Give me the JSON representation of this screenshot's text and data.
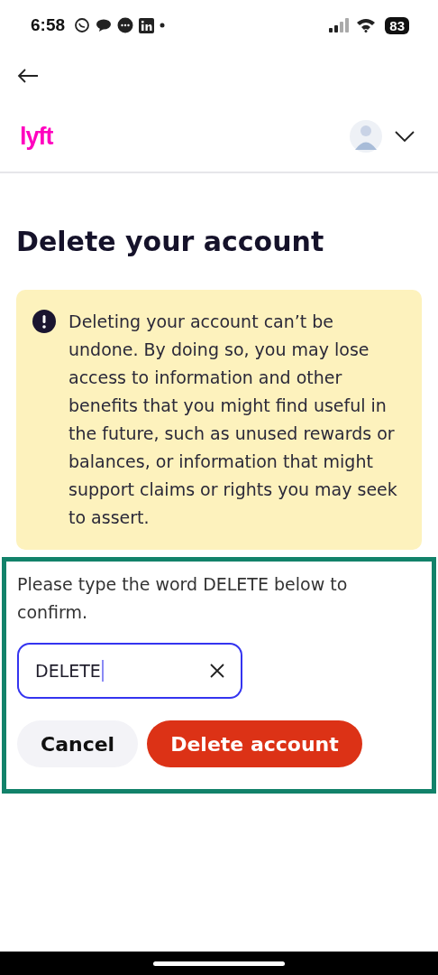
{
  "status_bar": {
    "time": "6:58",
    "battery": "83"
  },
  "header": {
    "logo": "lyft"
  },
  "title": "Delete your account",
  "warning": {
    "text": "Deleting your account can’t be undone. By doing so, you may lose access to information and other benefits that you might find useful in the future, such as unused rewards or balances, or information that might support claims or rights you may seek to assert."
  },
  "confirm": {
    "prompt": "Please type the word DELETE below to confirm.",
    "value": "DELETE",
    "focused": true
  },
  "buttons": [
    {
      "label": "Cancel",
      "kind": "secondary"
    },
    {
      "label": "Delete account",
      "kind": "danger"
    }
  ]
}
